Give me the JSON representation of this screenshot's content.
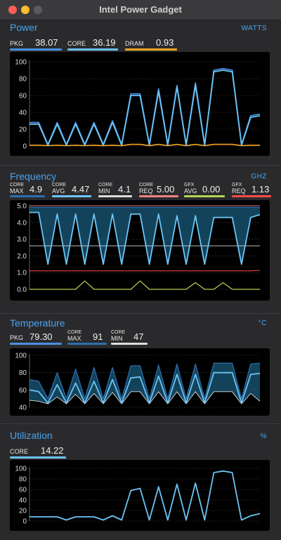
{
  "window": {
    "title": "Intel Power Gadget"
  },
  "colors": {
    "accent": "#4aa3f0",
    "pkg": "#4a90e2",
    "core": "#6cc4f4",
    "dram": "#f5a623",
    "core_max": "#2c6fb0",
    "core_min": "#dcdcdc",
    "core_req": "#f08080",
    "gfx_avg": "#b4d455",
    "gfx_req": "#ff4b4b",
    "fill": "#1a5a7a"
  },
  "power": {
    "title": "Power",
    "unit": "WATTS",
    "metrics": [
      {
        "label": "PKG",
        "value": "38.07"
      },
      {
        "label": "CORE",
        "value": "36.19"
      },
      {
        "label": "DRAM",
        "value": "0.93"
      }
    ],
    "y_ticks": [
      "100",
      "80",
      "60",
      "40",
      "20",
      "0"
    ]
  },
  "frequency": {
    "title": "Frequency",
    "unit": "GHZ",
    "metrics": [
      {
        "top": "CORE",
        "bottom": "MAX",
        "value": "4.9"
      },
      {
        "top": "CORE",
        "bottom": "AVG",
        "value": "4.47"
      },
      {
        "top": "CORE",
        "bottom": "MIN",
        "value": "4.1"
      },
      {
        "top": "CORE",
        "bottom": "REQ",
        "value": "5.00"
      },
      {
        "top": "GFX",
        "bottom": "AVG",
        "value": "0.00"
      },
      {
        "top": "GFX",
        "bottom": "REQ",
        "value": "1.13"
      }
    ],
    "y_ticks": [
      "5.0",
      "4.0",
      "3.0",
      "2.0",
      "1.0",
      "0.0"
    ]
  },
  "temperature": {
    "title": "Temperature",
    "unit": "°C",
    "metrics": [
      {
        "label": "PKG",
        "value": "79.30"
      },
      {
        "top": "CORE",
        "bottom": "MAX",
        "value": "91"
      },
      {
        "top": "CORE",
        "bottom": "MIN",
        "value": "47"
      }
    ],
    "y_ticks": [
      "100",
      "80",
      "60",
      "40"
    ]
  },
  "utilization": {
    "title": "Utilization",
    "unit": "%",
    "metrics": [
      {
        "label": "CORE",
        "value": "14.22"
      }
    ],
    "y_ticks": [
      "100",
      "80",
      "60",
      "40",
      "20",
      "0"
    ]
  },
  "chart_data": [
    {
      "type": "line",
      "title": "Power",
      "ylim": [
        0,
        100
      ],
      "x": [
        0,
        4,
        8,
        12,
        16,
        20,
        24,
        28,
        32,
        36,
        40,
        44,
        48,
        52,
        56,
        60,
        64,
        68,
        72,
        76,
        80,
        84,
        88,
        92,
        96,
        100
      ],
      "series": [
        {
          "name": "PKG",
          "values": [
            28,
            28,
            2,
            28,
            2,
            28,
            2,
            28,
            2,
            30,
            2,
            62,
            62,
            2,
            68,
            2,
            72,
            2,
            75,
            2,
            90,
            92,
            90,
            2,
            36,
            38
          ]
        },
        {
          "name": "CORE",
          "values": [
            26,
            26,
            1,
            26,
            1,
            26,
            1,
            26,
            1,
            28,
            1,
            60,
            60,
            1,
            65,
            1,
            70,
            1,
            72,
            1,
            88,
            90,
            88,
            1,
            34,
            36
          ]
        },
        {
          "name": "DRAM",
          "values": [
            1,
            1,
            0.5,
            1,
            0.5,
            1,
            0.5,
            1,
            0.5,
            1,
            0.5,
            2,
            2,
            0.5,
            2,
            0.5,
            2,
            0.5,
            2,
            0.5,
            2,
            2,
            2,
            0.5,
            1,
            1
          ]
        }
      ]
    },
    {
      "type": "line",
      "title": "Frequency",
      "ylim": [
        0,
        5
      ],
      "x": [
        0,
        4,
        8,
        12,
        16,
        20,
        24,
        28,
        32,
        36,
        40,
        44,
        48,
        52,
        56,
        60,
        64,
        68,
        72,
        76,
        80,
        84,
        88,
        92,
        96,
        100
      ],
      "series": [
        {
          "name": "CORE MAX",
          "values": [
            4.9,
            4.9,
            4.9,
            4.9,
            4.9,
            4.9,
            4.9,
            4.9,
            4.9,
            4.9,
            4.9,
            4.9,
            4.9,
            4.9,
            4.9,
            4.9,
            4.9,
            4.9,
            4.9,
            4.9,
            4.9,
            4.9,
            4.9,
            4.9,
            4.9,
            4.9
          ]
        },
        {
          "name": "CORE AVG",
          "values": [
            4.6,
            4.6,
            1.5,
            4.5,
            1.5,
            4.5,
            1.5,
            4.5,
            1.5,
            4.5,
            1.5,
            4.5,
            4.5,
            1.5,
            4.5,
            1.5,
            4.4,
            1.5,
            4.4,
            1.5,
            4.3,
            4.3,
            4.3,
            1.5,
            4.3,
            4.47
          ]
        },
        {
          "name": "CORE MIN",
          "values": [
            2.6,
            2.6,
            2.6,
            2.6,
            2.6,
            2.6,
            2.6,
            2.6,
            2.6,
            2.6,
            2.6,
            2.6,
            2.6,
            2.6,
            2.6,
            2.6,
            2.6,
            2.6,
            2.6,
            2.6,
            2.6,
            2.6,
            2.6,
            2.6,
            2.6,
            2.6
          ]
        },
        {
          "name": "CORE REQ",
          "values": [
            5,
            5,
            5,
            5,
            5,
            5,
            5,
            5,
            5,
            5,
            5,
            5,
            5,
            5,
            5,
            5,
            5,
            5,
            5,
            5,
            5,
            5,
            5,
            5,
            5,
            5
          ]
        },
        {
          "name": "GFX AVG",
          "values": [
            0,
            0,
            0,
            0,
            0,
            0,
            0.5,
            0,
            0,
            0,
            0,
            0,
            0.5,
            0,
            0,
            0,
            0,
            0,
            0.4,
            0,
            0,
            0.4,
            0,
            0,
            0,
            0
          ]
        },
        {
          "name": "GFX REQ",
          "values": [
            1.1,
            1.1,
            1.1,
            1.1,
            1.1,
            1.1,
            1.1,
            1.1,
            1.1,
            1.1,
            1.1,
            1.1,
            1.1,
            1.1,
            1.1,
            1.1,
            1.1,
            1.1,
            1.1,
            1.1,
            1.1,
            1.1,
            1.1,
            1.1,
            1.1,
            1.13
          ]
        }
      ]
    },
    {
      "type": "line",
      "title": "Temperature",
      "ylim": [
        40,
        100
      ],
      "x": [
        0,
        4,
        8,
        12,
        16,
        20,
        24,
        28,
        32,
        36,
        40,
        44,
        48,
        52,
        56,
        60,
        64,
        68,
        72,
        76,
        80,
        84,
        88,
        92,
        96,
        100
      ],
      "series": [
        {
          "name": "PKG",
          "values": [
            60,
            58,
            45,
            66,
            45,
            68,
            45,
            70,
            45,
            72,
            45,
            74,
            75,
            45,
            76,
            45,
            78,
            45,
            78,
            45,
            80,
            80,
            80,
            45,
            78,
            79
          ]
        },
        {
          "name": "CORE MAX",
          "values": [
            72,
            70,
            50,
            80,
            50,
            84,
            50,
            86,
            50,
            86,
            50,
            88,
            88,
            50,
            89,
            50,
            90,
            50,
            90,
            50,
            91,
            91,
            91,
            50,
            90,
            91
          ]
        },
        {
          "name": "CORE MIN",
          "values": [
            48,
            47,
            44,
            52,
            44,
            55,
            44,
            56,
            44,
            57,
            44,
            58,
            58,
            44,
            58,
            44,
            58,
            44,
            58,
            44,
            58,
            58,
            58,
            44,
            56,
            47
          ]
        }
      ]
    },
    {
      "type": "line",
      "title": "Utilization",
      "ylim": [
        0,
        100
      ],
      "x": [
        0,
        4,
        8,
        12,
        16,
        20,
        24,
        28,
        32,
        36,
        40,
        44,
        48,
        52,
        56,
        60,
        64,
        68,
        72,
        76,
        80,
        84,
        88,
        92,
        96,
        100
      ],
      "series": [
        {
          "name": "CORE",
          "values": [
            8,
            8,
            8,
            8,
            2,
            8,
            8,
            8,
            2,
            10,
            2,
            58,
            62,
            2,
            65,
            2,
            70,
            2,
            72,
            2,
            92,
            95,
            92,
            2,
            10,
            14
          ]
        }
      ]
    }
  ]
}
